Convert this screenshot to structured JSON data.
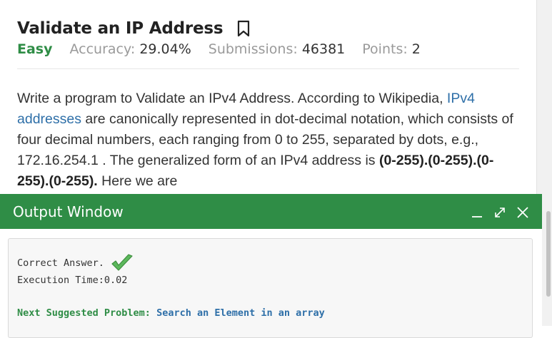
{
  "problem": {
    "title": "Validate an IP Address",
    "difficulty": "Easy",
    "accuracy_label": "Accuracy:",
    "accuracy_value": "29.04%",
    "submissions_label": "Submissions:",
    "submissions_value": "46381",
    "points_label": "Points:",
    "points_value": "2"
  },
  "description": {
    "text1": "Write a program to Validate an IPv4 Address. According to Wikipedia, ",
    "link": "IPv4 addresses",
    "text2": " are canonically represented in dot-decimal notation, which consists of four decimal numbers, each ranging from 0 to 255, separated by dots, e.g., 172.16.254.1 . The generalized form of an IPv4 address is ",
    "bold": "(0-255).(0-255).(0-255).(0-255).",
    "text3": " Here we are"
  },
  "output_window": {
    "title": "Output Window",
    "result": "Correct Answer.",
    "execution_time": "Execution Time:0.02",
    "next_label": "Next Suggested Problem:",
    "next_problem": "Search an Element in an array"
  },
  "colors": {
    "accent_green": "#2f8d46",
    "link_blue": "#2e6fa8"
  },
  "icons": [
    "bookmark-icon",
    "minimize-icon",
    "maximize-icon",
    "close-icon",
    "checkmark-icon"
  ]
}
